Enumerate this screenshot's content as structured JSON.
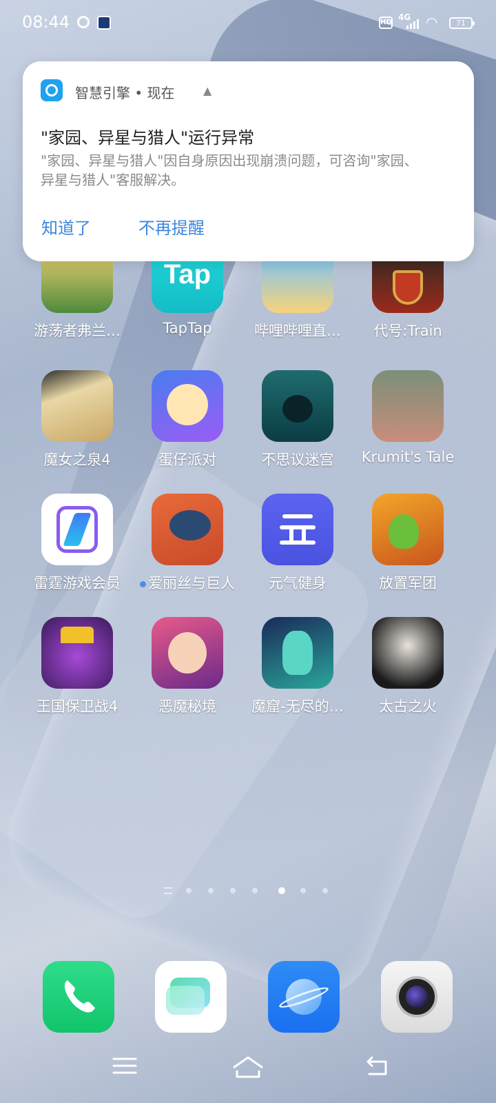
{
  "status_bar": {
    "time": "08:44",
    "hd_label": "HD",
    "network": "4G",
    "battery": "71"
  },
  "notification": {
    "app_name": "智慧引擎 • 现在",
    "title": "\"家园、异星与猎人\"运行异常",
    "body": "\"家园、异星与猎人\"因自身原因出现崩溃问题，可咨询\"家园、异星与猎人\"客服解决。",
    "button_ok": "知道了",
    "button_mute": "不再提醒"
  },
  "apps": [
    {
      "label": "游荡者弗兰…",
      "icon": "wanderer-frans-icon"
    },
    {
      "label": "TapTap",
      "icon": "taptap-icon"
    },
    {
      "label": "哔哩哔哩直…",
      "icon": "bilibili-live-icon"
    },
    {
      "label": "代号:Train",
      "icon": "train-icon"
    },
    {
      "label": "魔女之泉4",
      "icon": "witch-spring-icon"
    },
    {
      "label": "蛋仔派对",
      "icon": "eggy-party-icon"
    },
    {
      "label": "不思议迷宫",
      "icon": "mystery-maze-icon"
    },
    {
      "label": "Krumit's Tale",
      "icon": "krumits-tale-icon"
    },
    {
      "label": "雷霆游戏会员",
      "icon": "thunder-games-icon"
    },
    {
      "label": "爱丽丝与巨人",
      "icon": "alice-giant-icon"
    },
    {
      "label": "元气健身",
      "icon": "fitness-icon"
    },
    {
      "label": "放置军团",
      "icon": "idle-legion-icon"
    },
    {
      "label": "王国保卫战4",
      "icon": "kingdom-rush-icon"
    },
    {
      "label": "恶魔秘境",
      "icon": "demon-realm-icon"
    },
    {
      "label": "魔窟-无尽的…",
      "icon": "dungeon-icon"
    },
    {
      "label": "太古之火",
      "icon": "ancient-fire-icon"
    }
  ],
  "dock": [
    {
      "icon": "phone-icon"
    },
    {
      "icon": "messages-icon"
    },
    {
      "icon": "browser-icon"
    },
    {
      "icon": "camera-icon"
    }
  ],
  "colors": {
    "accent": "#3a86e0",
    "new_badge": "#4a90e2"
  }
}
